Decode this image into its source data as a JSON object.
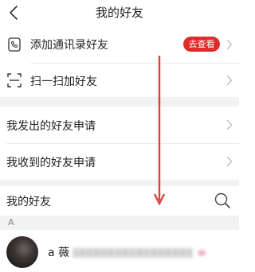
{
  "header": {
    "title": "我的好友"
  },
  "menu": {
    "add_contacts_label": "添加通讯录好友",
    "add_contacts_badge": "去查看",
    "scan_label": "扫一扫加好友",
    "sent_requests_label": "我发出的好友申请",
    "received_requests_label": "我收到的好友申请"
  },
  "friends": {
    "heading": "我的好友",
    "section_letter": "A",
    "contacts": [
      {
        "name": "a 薇"
      }
    ]
  },
  "colors": {
    "accent": "#e02b2b",
    "arrow": "#d9433d",
    "separator": "#f2f2f2"
  },
  "icons": {
    "back": "chevron-left-icon",
    "contacts": "phone-book-icon",
    "scan": "scan-icon",
    "search": "search-icon",
    "chevron": "chevron-right-icon"
  }
}
